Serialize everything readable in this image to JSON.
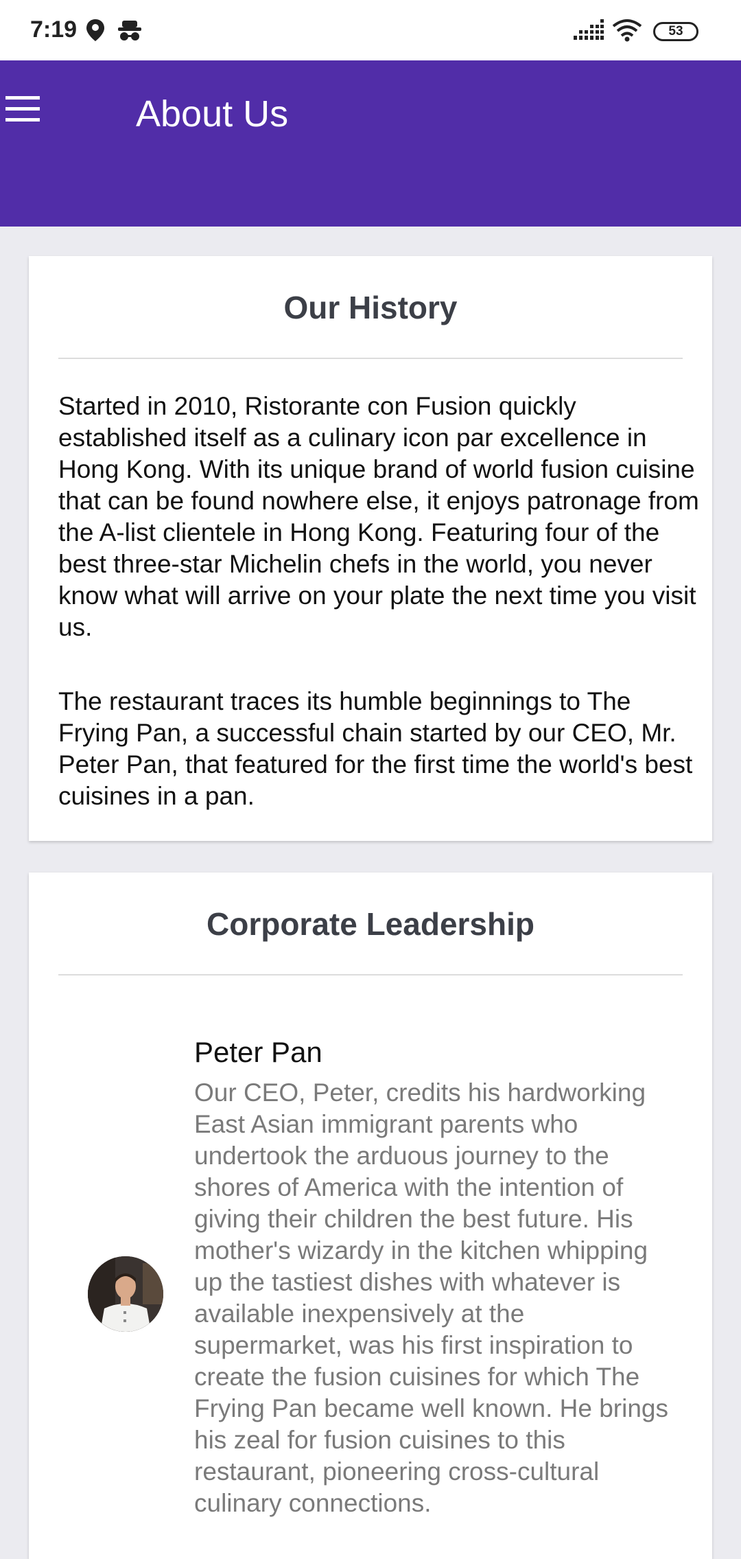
{
  "status_bar": {
    "time": "7:19",
    "battery": "53",
    "icons": [
      "location-icon",
      "incognito-icon",
      "signal-icon",
      "wifi-icon",
      "battery-icon"
    ]
  },
  "toolbar": {
    "title": "About Us",
    "color": "#512da8",
    "menu_icon": "menu-icon"
  },
  "history": {
    "title": "Our History",
    "paragraphs": [
      "Started in 2010, Ristorante con Fusion quickly established itself as a culinary icon par excellence in Hong Kong. With its unique brand of world fusion cuisine that can be found nowhere else, it enjoys patronage from the A-list clientele in Hong Kong. Featuring four of the best three-star Michelin chefs in the world, you never know what will arrive on your plate the next time you visit us.",
      "The restaurant traces its humble beginnings to The Frying Pan, a successful chain started by our CEO, Mr. Peter Pan, that featured for the first time the world's best cuisines in a pan."
    ]
  },
  "leadership": {
    "title": "Corporate Leadership",
    "leaders": [
      {
        "name": "Peter Pan",
        "description": "Our CEO, Peter, credits his hardworking East Asian immigrant parents who undertook the arduous journey to the shores of America with the intention of giving their children the best future. His mother's wizardy in the kitchen whipping up the tastiest dishes with whatever is available inexpensively at the supermarket, was his first inspiration to create the fusion cuisines for which The Frying Pan became well known. He brings his zeal for fusion cuisines to this restaurant, pioneering cross-cultural culinary connections."
      }
    ]
  }
}
